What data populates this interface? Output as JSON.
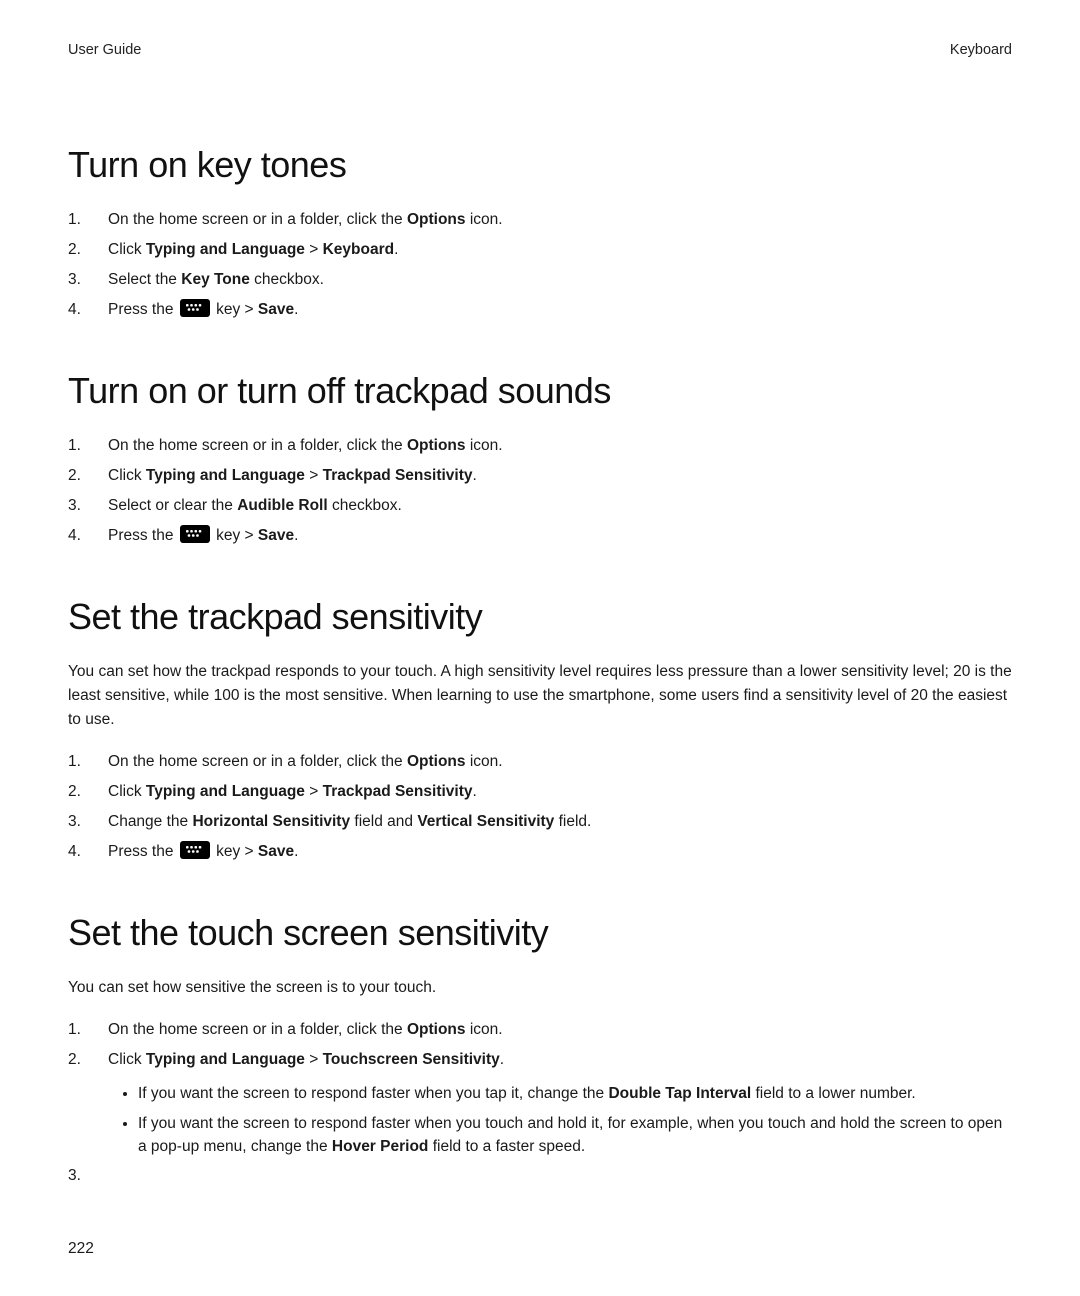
{
  "header": {
    "left": "User Guide",
    "right": "Keyboard"
  },
  "pageNumber": "222",
  "sections": [
    {
      "id": "key-tones",
      "title": "Turn on key tones",
      "intro": null,
      "steps": [
        {
          "pre": "On the home screen or in a folder, click the ",
          "b1": "Options",
          "mid1": " icon."
        },
        {
          "pre": "Click ",
          "b1": "Typing and Language",
          "mid1": " > ",
          "b2": "Keyboard",
          "mid2": "."
        },
        {
          "pre": "Select the ",
          "b1": "Key Tone",
          "mid1": " checkbox."
        },
        {
          "pre": "Press the ",
          "icon": true,
          "mid1": " key > ",
          "b1": "Save",
          "mid2": "."
        }
      ]
    },
    {
      "id": "trackpad-sounds",
      "title": "Turn on or turn off trackpad sounds",
      "intro": null,
      "steps": [
        {
          "pre": "On the home screen or in a folder, click the ",
          "b1": "Options",
          "mid1": " icon."
        },
        {
          "pre": "Click ",
          "b1": "Typing and Language",
          "mid1": " > ",
          "b2": "Trackpad Sensitivity",
          "mid2": "."
        },
        {
          "pre": "Select or clear the ",
          "b1": "Audible Roll",
          "mid1": " checkbox."
        },
        {
          "pre": "Press the ",
          "icon": true,
          "mid1": " key > ",
          "b1": "Save",
          "mid2": "."
        }
      ]
    },
    {
      "id": "trackpad-sensitivity",
      "title": "Set the trackpad sensitivity",
      "intro": "You can set how the trackpad responds to your touch. A high sensitivity level requires less pressure than a lower sensitivity level; 20 is the least sensitive, while 100 is the most sensitive. When learning to use the smartphone, some users find a sensitivity level of 20 the easiest to use.",
      "steps": [
        {
          "pre": "On the home screen or in a folder, click the ",
          "b1": "Options",
          "mid1": " icon."
        },
        {
          "pre": "Click ",
          "b1": "Typing and Language",
          "mid1": " > ",
          "b2": "Trackpad Sensitivity",
          "mid2": "."
        },
        {
          "pre": "Change the ",
          "b1": "Horizontal Sensitivity",
          "mid1": " field and ",
          "b2": "Vertical Sensitivity",
          "mid2": " field."
        },
        {
          "pre": "Press the ",
          "icon": true,
          "mid1": " key > ",
          "b1": "Save",
          "mid2": "."
        }
      ]
    },
    {
      "id": "touch-screen-sensitivity",
      "title": "Set the touch screen sensitivity",
      "intro": "You can set how sensitive the screen is to your touch.",
      "steps": [
        {
          "pre": "On the home screen or in a folder, click the ",
          "b1": "Options",
          "mid1": " icon."
        },
        {
          "pre": "Click ",
          "b1": "Typing and Language",
          "mid1": " > ",
          "b2": "Touchscreen Sensitivity",
          "mid2": ".",
          "bullets": [
            {
              "pre": "If you want the screen to respond faster when you tap it, change the ",
              "b1": "Double Tap Interval",
              "post": " field to a lower number."
            },
            {
              "pre": "If you want the screen to respond faster when you touch and hold it, for example, when you touch and hold the screen to open a pop-up menu, change the ",
              "b1": "Hover Period",
              "post": " field to a faster speed."
            }
          ]
        },
        {
          "pre": ""
        }
      ]
    }
  ]
}
